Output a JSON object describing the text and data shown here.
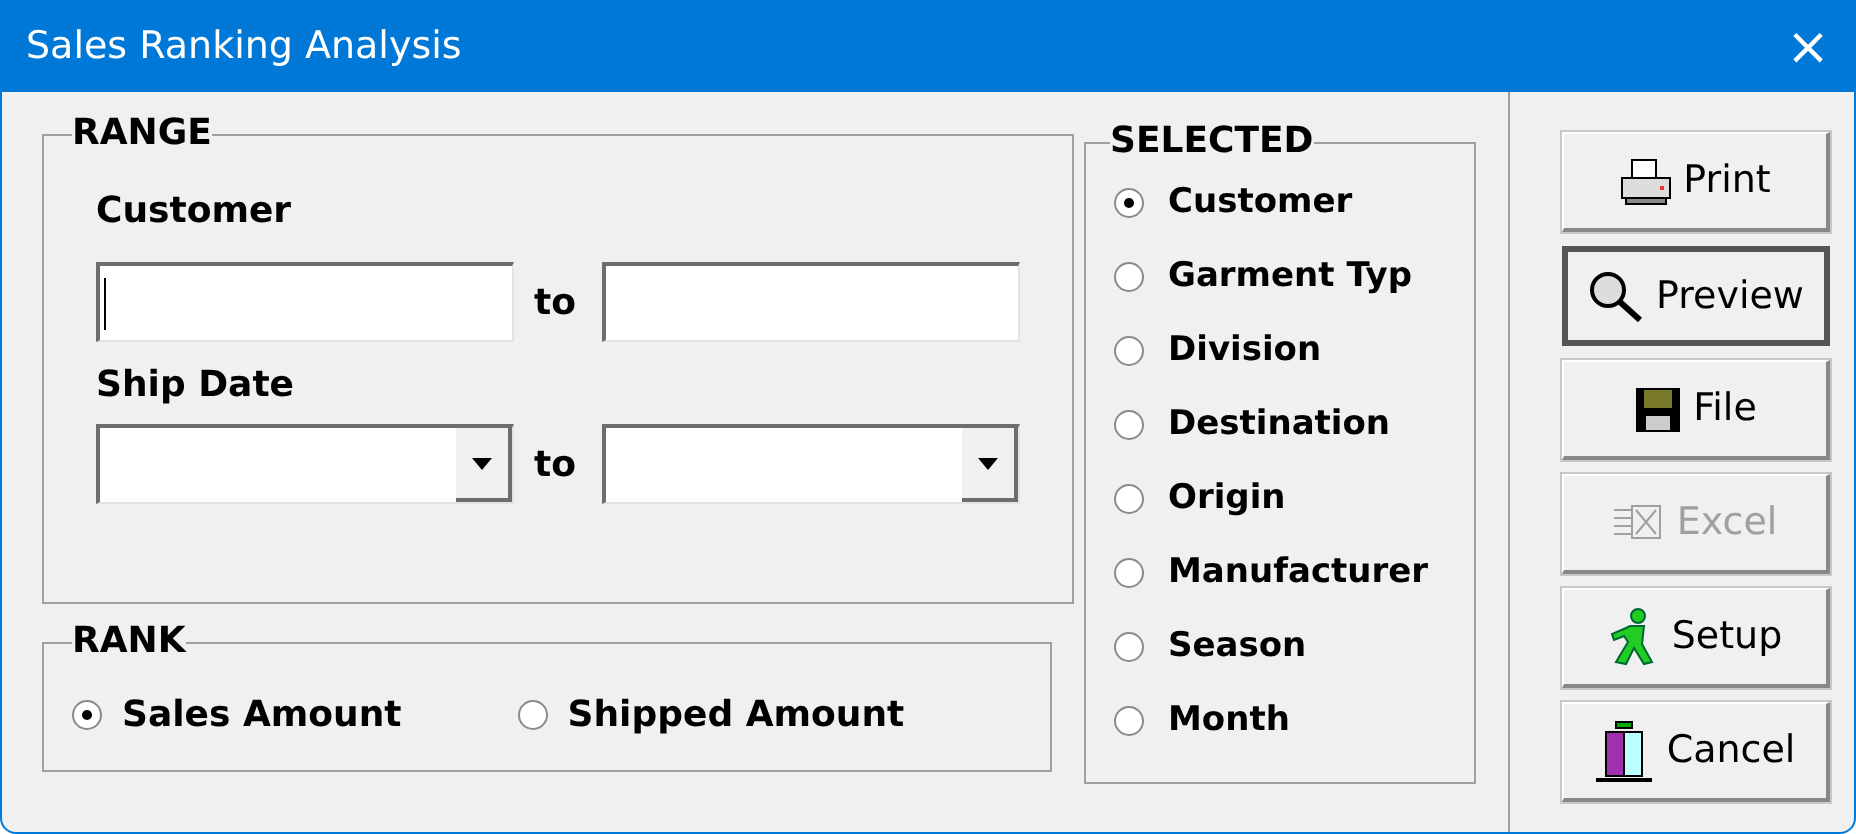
{
  "window": {
    "title": "Sales Ranking Analysis",
    "close": "×"
  },
  "range": {
    "title": "RANGE",
    "customer": {
      "label": "Customer",
      "from": {
        "focused": true
      },
      "separator": "to",
      "to": {
        "focused": false
      }
    },
    "ship_date": {
      "label": "Ship Date",
      "separator": "to"
    }
  },
  "rank": {
    "title": "RANK",
    "options": [
      {
        "label": "Sales Amount",
        "selected": true
      },
      {
        "label": "Shipped Amount",
        "selected": false
      }
    ]
  },
  "selected": {
    "title": "SELECTED",
    "options": [
      {
        "label": "Customer",
        "selected": true
      },
      {
        "label": "Garment Typ",
        "selected": false
      },
      {
        "label": "Division",
        "selected": false
      },
      {
        "label": "Destination",
        "selected": false
      },
      {
        "label": "Origin",
        "selected": false
      },
      {
        "label": "Manufacturer",
        "selected": false
      },
      {
        "label": "Season",
        "selected": false
      },
      {
        "label": "Month",
        "selected": false
      }
    ]
  },
  "buttons": [
    {
      "label": "Print",
      "disabled": false,
      "default": false
    },
    {
      "label": "Preview",
      "disabled": false,
      "default": true
    },
    {
      "label": "File",
      "disabled": false,
      "default": false
    },
    {
      "label": "Excel",
      "disabled": true,
      "default": false
    },
    {
      "label": "Setup",
      "disabled": false,
      "default": false
    },
    {
      "label": "Cancel",
      "disabled": false,
      "default": false
    }
  ]
}
